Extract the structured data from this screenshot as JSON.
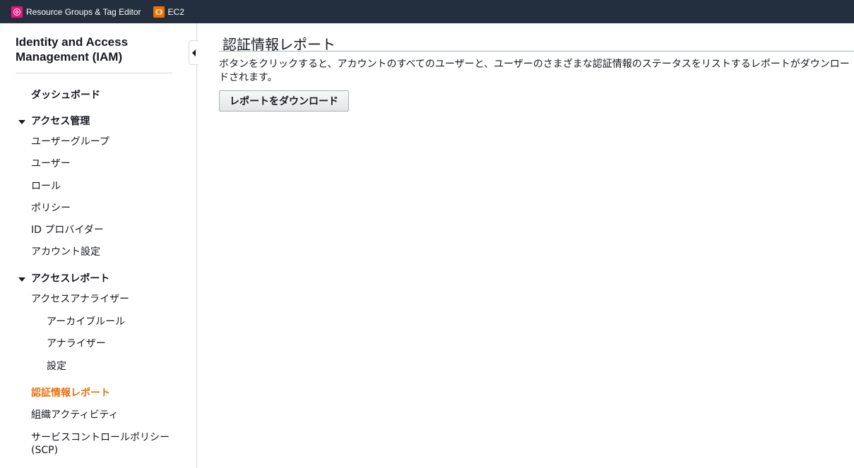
{
  "topbar": {
    "favorites": [
      {
        "label": "Resource Groups & Tag Editor",
        "icon": "resource-groups-icon",
        "color": "#e7157b"
      },
      {
        "label": "EC2",
        "icon": "ec2-icon",
        "color": "#ed7100"
      }
    ]
  },
  "sidebar": {
    "title": "Identity and Access Management (IAM)",
    "dashboard": "ダッシュボード",
    "access_management": {
      "label": "アクセス管理",
      "items": [
        "ユーザーグループ",
        "ユーザー",
        "ロール",
        "ポリシー",
        "ID プロバイダー",
        "アカウント設定"
      ]
    },
    "access_reports": {
      "label": "アクセスレポート",
      "analyzer": "アクセスアナライザー",
      "analyzer_children": [
        "アーカイブルール",
        "アナライザー",
        "設定"
      ],
      "credential_report": "認証情報レポート",
      "organization_activity": "組織アクティビティ",
      "scp": "サービスコントロールポリシー (SCP)"
    },
    "active_color": "#ec7211"
  },
  "main": {
    "title": "認証情報レポート",
    "description": "ボタンをクリックすると、アカウントのすべてのユーザーと、ユーザーのさまざまな認証情報のステータスをリストするレポートがダウンロードされます。",
    "download_button": "レポートをダウンロード"
  }
}
